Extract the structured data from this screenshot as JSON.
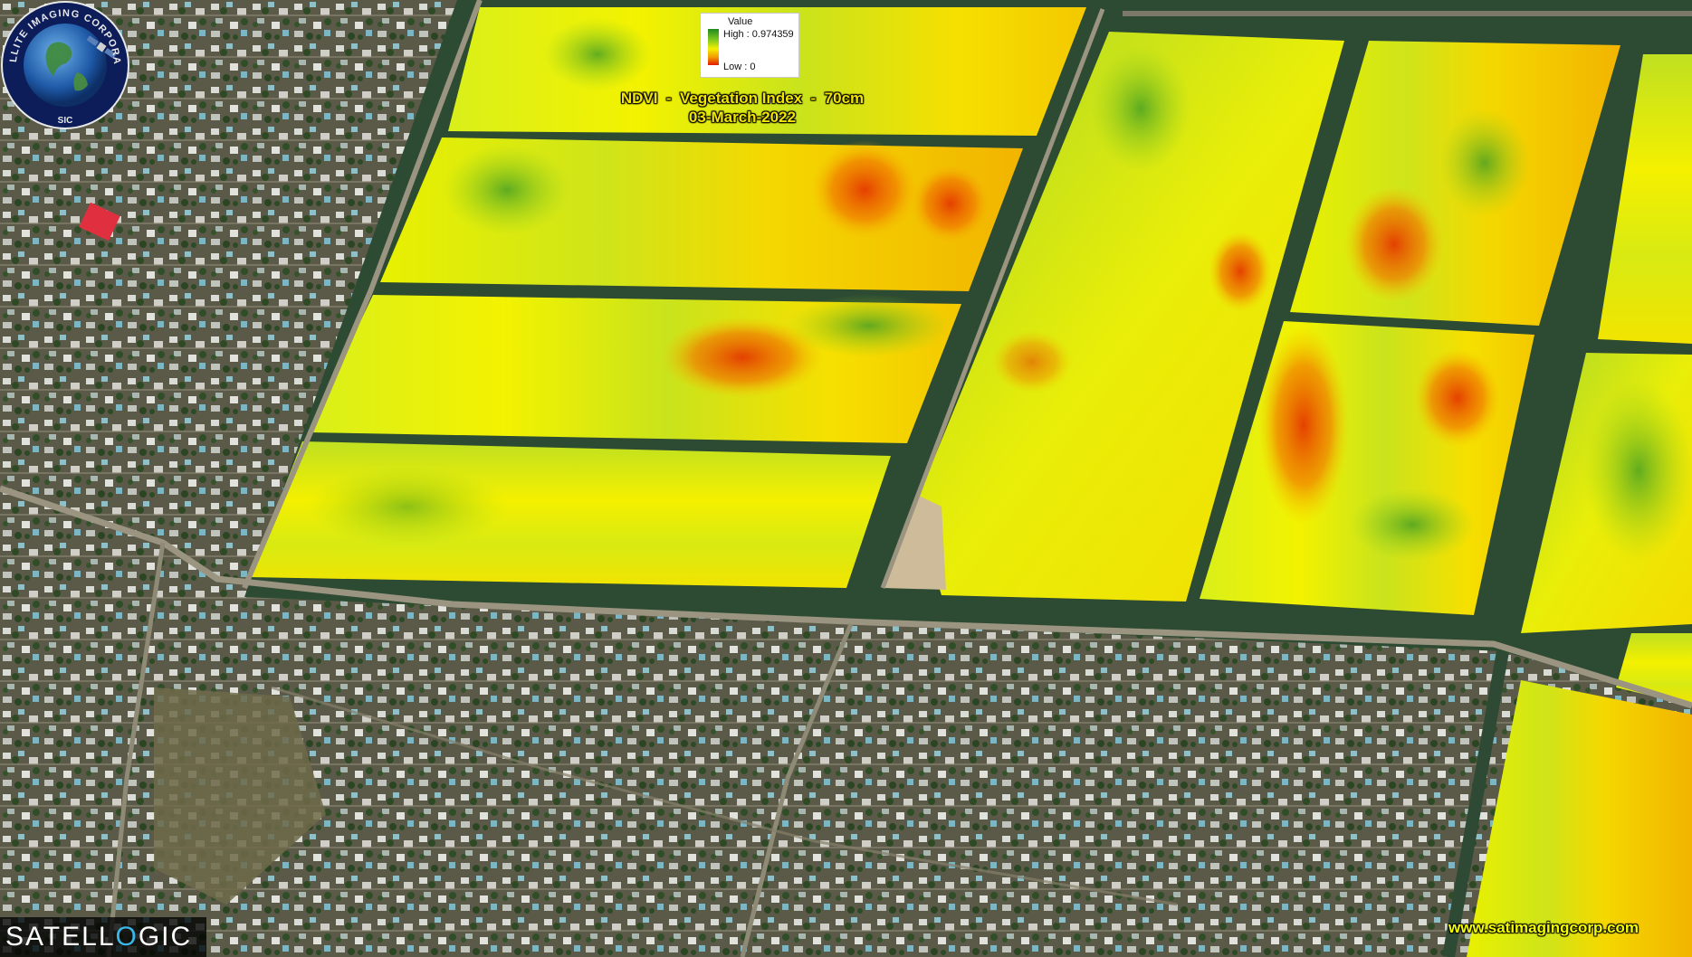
{
  "legend": {
    "title": "Value",
    "high_label": "High : 0.974359",
    "low_label": "Low : 0",
    "high_value": 0.974359,
    "low_value": 0,
    "ramp_colors": [
      "#1f8a1f",
      "#7fc91e",
      "#f5f000",
      "#f39a00",
      "#e21a00"
    ]
  },
  "title": {
    "line1": "NDVI  -  Vegetation Index  -  70cm",
    "line2": "03-March-2022",
    "color": "#f2e600"
  },
  "brand": {
    "text_before": "SATELL",
    "mark": "O",
    "text_after": "GIC"
  },
  "seal": {
    "arc_text": "SATELLITE IMAGING CORPORATION",
    "center_text": "SIC",
    "icons": [
      "earth-globe-icon",
      "satellite-icon"
    ]
  },
  "website": "www.satimagingcorp.com",
  "colors": {
    "ndvi_high": "#1f8a1f",
    "ndvi_mid": "#f5f000",
    "ndvi_low": "#e21a00",
    "road": "#2e4a34",
    "urban": "#5a5a48"
  }
}
